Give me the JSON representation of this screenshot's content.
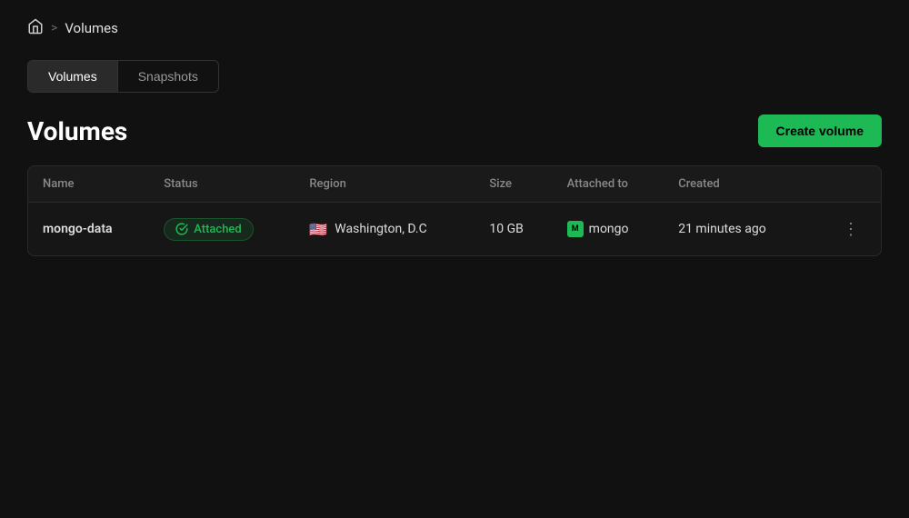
{
  "breadcrumb": {
    "home_label": "Home",
    "separator": ">",
    "current": "Volumes"
  },
  "tabs": [
    {
      "id": "volumes",
      "label": "Volumes",
      "active": true
    },
    {
      "id": "snapshots",
      "label": "Snapshots",
      "active": false
    }
  ],
  "page": {
    "title": "Volumes",
    "create_button_label": "Create volume"
  },
  "table": {
    "columns": [
      {
        "id": "name",
        "label": "Name"
      },
      {
        "id": "status",
        "label": "Status"
      },
      {
        "id": "region",
        "label": "Region"
      },
      {
        "id": "size",
        "label": "Size"
      },
      {
        "id": "attached_to",
        "label": "Attached to"
      },
      {
        "id": "created",
        "label": "Created"
      }
    ],
    "rows": [
      {
        "name": "mongo-data",
        "status": "Attached",
        "region": "Washington, D.C",
        "size": "10 GB",
        "attached_to": "mongo",
        "created": "21 minutes ago"
      }
    ]
  },
  "colors": {
    "accent": "#1db954",
    "background": "#111111",
    "surface": "#161616"
  }
}
